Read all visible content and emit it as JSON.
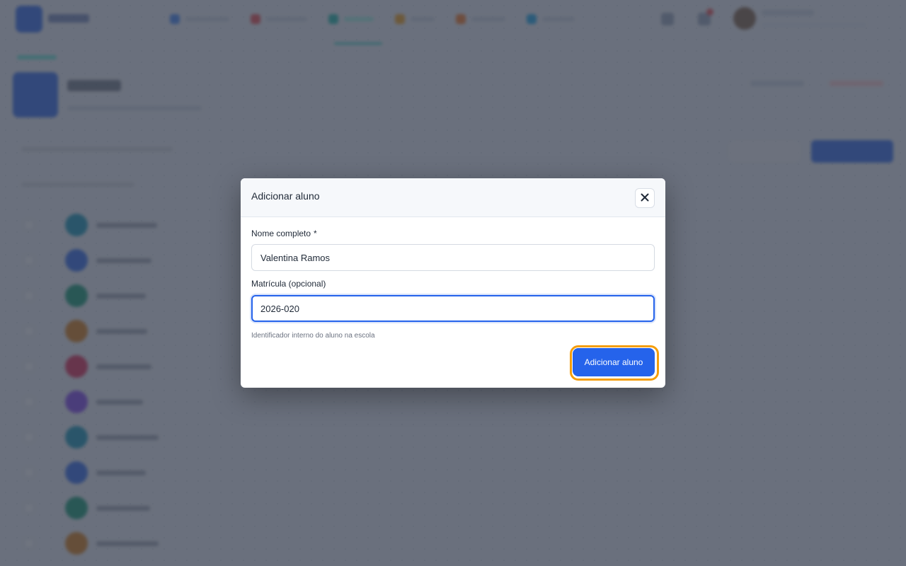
{
  "modal": {
    "title": "Adicionar aluno",
    "name_label": "Nome completo",
    "name_required": "*",
    "name_value": "Valentina Ramos",
    "enrollment_label": "Matrícula (opcional)",
    "enrollment_value": "2026-020",
    "enrollment_help": "Identificador interno do aluno na escola",
    "submit_label": "Adicionar aluno",
    "close_icon": "close-icon"
  },
  "colors": {
    "accent": "#2563eb",
    "focus_ring": "#f59e0b",
    "overlay": "#373e4e"
  },
  "background": {
    "nav_icons": [
      "home-icon",
      "book-icon",
      "users-icon",
      "chart-icon",
      "calendar-icon",
      "settings-icon"
    ],
    "nav_colors": [
      "#3b82f6",
      "#ef4444",
      "#14b8a6",
      "#f59e0b",
      "#f97316",
      "#0ea5e9"
    ],
    "row_colors": [
      "#0891b2",
      "#2563eb",
      "#059669",
      "#d97706",
      "#e11d48",
      "#7c3aed",
      "#0891b2",
      "#2563eb",
      "#059669",
      "#d97706"
    ]
  }
}
